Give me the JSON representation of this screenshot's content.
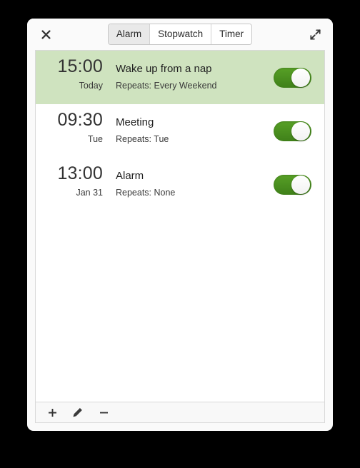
{
  "window": {
    "close_icon": "close-icon",
    "expand_icon": "expand-icon"
  },
  "tabs": [
    {
      "label": "Alarm",
      "active": true
    },
    {
      "label": "Stopwatch",
      "active": false
    },
    {
      "label": "Timer",
      "active": false
    }
  ],
  "alarms": [
    {
      "time": "15:00",
      "label": "Wake up from a nap",
      "date": "Today",
      "repeats": "Repeats: Every Weekend",
      "enabled": true,
      "selected": true
    },
    {
      "time": "09:30",
      "label": "Meeting",
      "date": "Tue",
      "repeats": "Repeats: Tue",
      "enabled": true,
      "selected": false
    },
    {
      "time": "13:00",
      "label": "Alarm",
      "date": "Jan 31",
      "repeats": "Repeats: None",
      "enabled": true,
      "selected": false
    }
  ],
  "toolbar": [
    {
      "name": "add-alarm-button",
      "icon": "plus-icon"
    },
    {
      "name": "edit-alarm-button",
      "icon": "pencil-icon"
    },
    {
      "name": "remove-alarm-button",
      "icon": "minus-icon"
    }
  ],
  "colors": {
    "toggle_on": "#4b9122",
    "row_selected": "#cfe3bf",
    "window_bg": "#fafafa",
    "desktop_bg": "#000000"
  }
}
